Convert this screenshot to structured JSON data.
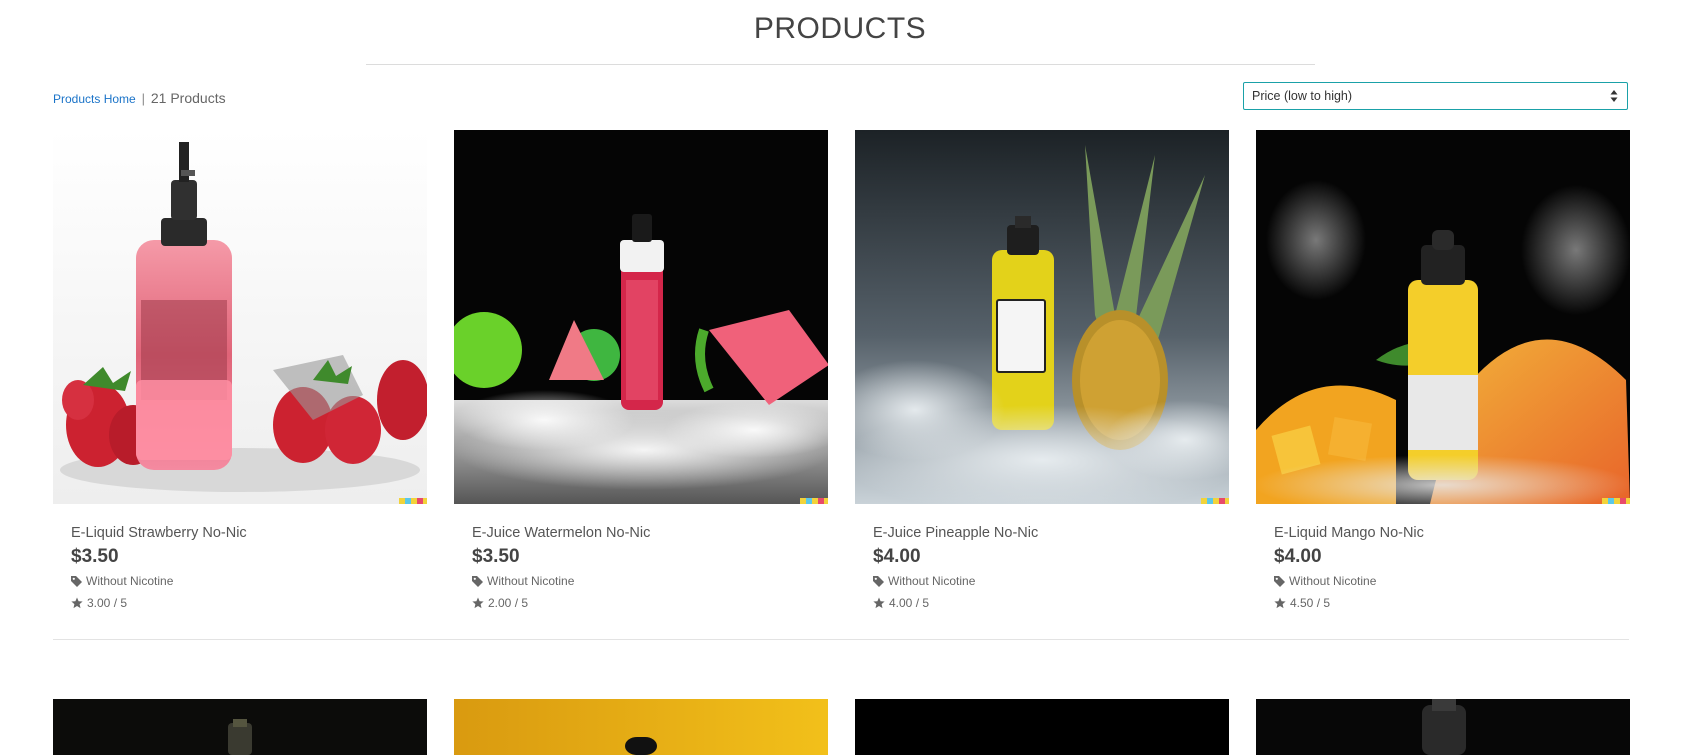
{
  "page": {
    "title": "PRODUCTS"
  },
  "breadcrumb": {
    "home_link": "Products Home",
    "separator": "|",
    "count": "21 Products"
  },
  "sort": {
    "selected": "Price (low to high)"
  },
  "products": [
    {
      "name": "E-Liquid Strawberry No-Nic",
      "price": "$3.50",
      "nicotine": "Without Nicotine",
      "rating": "3.00 / 5"
    },
    {
      "name": "E-Juice Watermelon No-Nic",
      "price": "$3.50",
      "nicotine": "Without Nicotine",
      "rating": "2.00 / 5"
    },
    {
      "name": "E-Juice Pineapple No-Nic",
      "price": "$4.00",
      "nicotine": "Without Nicotine",
      "rating": "4.00 / 5"
    },
    {
      "name": "E-Liquid Mango No-Nic",
      "price": "$4.00",
      "nicotine": "Without Nicotine",
      "rating": "4.50 / 5"
    }
  ],
  "icons": {
    "tag": "tag-icon",
    "star": "star-icon",
    "sort_arrows": "sort-arrows-icon"
  },
  "colors": {
    "link": "#1a73c8",
    "select_border": "#1aa1a8"
  }
}
